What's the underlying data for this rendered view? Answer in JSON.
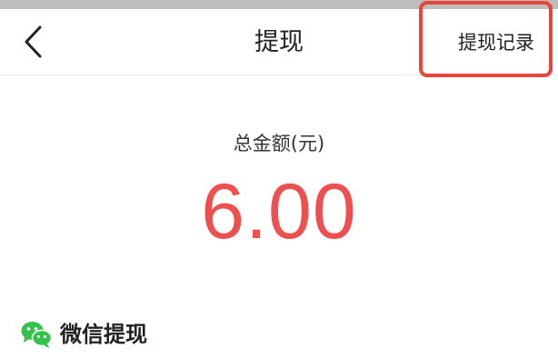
{
  "nav": {
    "title": "提现",
    "history_link": "提现记录",
    "back_icon": "chevron-left-icon"
  },
  "balance": {
    "label": "总金额(元)",
    "amount": "6.00"
  },
  "withdraw_method": {
    "label": "微信提现",
    "icon": "wechat-icon"
  },
  "colors": {
    "amount": "#ee5050",
    "highlight_border": "#e8453c",
    "wechat_green": "#35c24a"
  }
}
